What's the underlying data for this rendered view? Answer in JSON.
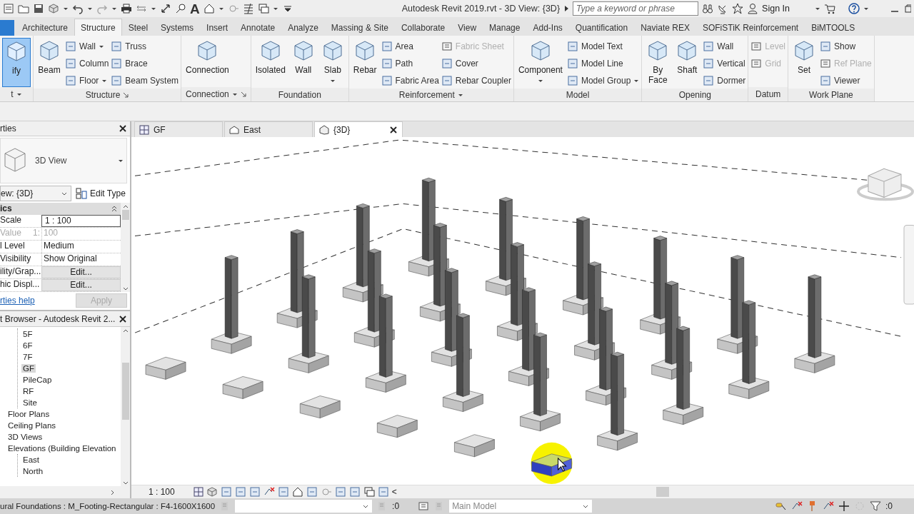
{
  "title_bar": {
    "text_tool": "A",
    "title": "Autodesk Revit 2019.rvt - 3D View: {3D}",
    "search": {
      "placeholder": "Type a keyword or phrase"
    },
    "sign_in": "Sign In"
  },
  "ribbon_tabs": [
    {
      "label": "Architecture",
      "selected": false
    },
    {
      "label": "Structure",
      "selected": true
    },
    {
      "label": "Steel",
      "selected": false
    },
    {
      "label": "Systems",
      "selected": false
    },
    {
      "label": "Insert",
      "selected": false
    },
    {
      "label": "Annotate",
      "selected": false
    },
    {
      "label": "Analyze",
      "selected": false
    },
    {
      "label": "Massing & Site",
      "selected": false
    },
    {
      "label": "Collaborate",
      "selected": false
    },
    {
      "label": "View",
      "selected": false
    },
    {
      "label": "Manage",
      "selected": false
    },
    {
      "label": "Add-Ins",
      "selected": false
    },
    {
      "label": "Quantification",
      "selected": false
    },
    {
      "label": "Naviate REX",
      "selected": false
    },
    {
      "label": "SOFiSTiK Reinforcement",
      "selected": false
    },
    {
      "label": "BiMTOOLS",
      "selected": false
    }
  ],
  "ribbon_panels": [
    {
      "title": "t",
      "menu": true,
      "launcher": false,
      "columns": [
        {
          "kind": "large",
          "label": "ify",
          "active": true,
          "dropdown": false
        }
      ]
    },
    {
      "title": "Structure",
      "menu": false,
      "launcher": true,
      "columns": [
        {
          "kind": "large",
          "label": "Beam",
          "active": false,
          "dropdown": false
        },
        {
          "kind": "stack",
          "items": [
            {
              "label": "Wall",
              "dropdown": true,
              "disabled": false
            },
            {
              "label": "Column",
              "dropdown": false,
              "disabled": false
            },
            {
              "label": "Floor",
              "dropdown": true,
              "disabled": false
            }
          ]
        },
        {
          "kind": "stack",
          "items": [
            {
              "label": "Truss",
              "dropdown": false,
              "disabled": false
            },
            {
              "label": "Brace",
              "dropdown": false,
              "disabled": false
            },
            {
              "label": "Beam System",
              "dropdown": false,
              "disabled": false
            }
          ]
        }
      ]
    },
    {
      "title": "Connection",
      "menu": true,
      "launcher": true,
      "columns": [
        {
          "kind": "large",
          "label": "Connection",
          "active": false,
          "dropdown": false
        }
      ]
    },
    {
      "title": "Foundation",
      "menu": false,
      "launcher": false,
      "columns": [
        {
          "kind": "large",
          "label": "Isolated",
          "active": false,
          "dropdown": false
        },
        {
          "kind": "large",
          "label": "Wall",
          "active": false,
          "dropdown": false
        },
        {
          "kind": "large",
          "label": "Slab",
          "active": false,
          "dropdown": true
        }
      ]
    },
    {
      "title": "Reinforcement",
      "menu": true,
      "launcher": false,
      "columns": [
        {
          "kind": "large",
          "label": "Rebar",
          "active": false,
          "dropdown": false
        },
        {
          "kind": "stack",
          "items": [
            {
              "label": "Area",
              "dropdown": false,
              "disabled": false
            },
            {
              "label": "Path",
              "dropdown": false,
              "disabled": false
            },
            {
              "label": "Fabric Area",
              "dropdown": false,
              "disabled": false
            }
          ]
        },
        {
          "kind": "stack",
          "items": [
            {
              "label": "Fabric Sheet",
              "dropdown": false,
              "disabled": true
            },
            {
              "label": "Cover",
              "dropdown": false,
              "disabled": false
            },
            {
              "label": "Rebar Coupler",
              "dropdown": false,
              "disabled": false
            }
          ]
        }
      ]
    },
    {
      "title": "Model",
      "menu": false,
      "launcher": false,
      "columns": [
        {
          "kind": "large",
          "label": "Component",
          "active": false,
          "dropdown": true
        },
        {
          "kind": "stack",
          "items": [
            {
              "label": "Model Text",
              "dropdown": false,
              "disabled": false
            },
            {
              "label": "Model Line",
              "dropdown": false,
              "disabled": false
            },
            {
              "label": "Model Group",
              "dropdown": true,
              "disabled": false
            }
          ]
        }
      ]
    },
    {
      "title": "Opening",
      "menu": false,
      "launcher": false,
      "columns": [
        {
          "kind": "large",
          "label": "By Face",
          "active": false,
          "dropdown": false
        },
        {
          "kind": "large",
          "label": "Shaft",
          "active": false,
          "dropdown": false
        },
        {
          "kind": "stack",
          "items": [
            {
              "label": "Wall",
              "dropdown": false,
              "disabled": false
            },
            {
              "label": "Vertical",
              "dropdown": false,
              "disabled": false
            },
            {
              "label": "Dormer",
              "dropdown": false,
              "disabled": false
            }
          ]
        }
      ]
    },
    {
      "title": "Datum",
      "menu": false,
      "launcher": false,
      "columns": [
        {
          "kind": "stack",
          "items": [
            {
              "label": "Level",
              "dropdown": false,
              "disabled": true
            },
            {
              "label": "Grid",
              "dropdown": false,
              "disabled": true
            }
          ]
        }
      ]
    },
    {
      "title": "Work Plane",
      "menu": false,
      "launcher": false,
      "columns": [
        {
          "kind": "large",
          "label": "Set",
          "active": false,
          "dropdown": false
        },
        {
          "kind": "stack",
          "items": [
            {
              "label": "Show",
              "dropdown": false,
              "disabled": false
            },
            {
              "label": "Ref Plane",
              "dropdown": false,
              "disabled": true
            },
            {
              "label": "Viewer",
              "dropdown": false,
              "disabled": false
            }
          ]
        }
      ]
    }
  ],
  "properties": {
    "title": "rties",
    "type_name": "3D View",
    "view_selector": "ew: {3D}",
    "edit_type": "Edit Type",
    "group": "ics",
    "rows": [
      {
        "kind": "input",
        "name": "Scale",
        "value": "1 : 100"
      },
      {
        "kind": "readonly",
        "name": "Value",
        "prefix": "1:",
        "value": "100"
      },
      {
        "kind": "text",
        "name": "l Level",
        "value": "Medium"
      },
      {
        "kind": "text",
        "name": "Visibility",
        "value": "Show Original"
      },
      {
        "kind": "button",
        "name": "ility/Grap...",
        "value": "Edit..."
      },
      {
        "kind": "button",
        "name": "hic Displ...",
        "value": "Edit..."
      }
    ],
    "help_link": "rties help",
    "apply": {
      "label": "Apply",
      "disabled": true
    }
  },
  "project_browser": {
    "title": "t Browser - Autodesk Revit 2...",
    "tree": [
      {
        "children": [
          {
            "label": "5F",
            "selected": false
          },
          {
            "label": "6F",
            "selected": false
          },
          {
            "label": "7F",
            "selected": false
          },
          {
            "label": "GF",
            "selected": true
          },
          {
            "label": "PileCap",
            "selected": false
          },
          {
            "label": "RF",
            "selected": false
          },
          {
            "label": "Site",
            "selected": false
          }
        ]
      },
      {
        "label": "Floor Plans",
        "selected": false
      },
      {
        "label": "Ceiling Plans",
        "selected": false
      },
      {
        "label": "3D Views",
        "selected": false
      },
      {
        "label": "Elevations (Building Elevation",
        "selected": false,
        "children": [
          {
            "label": "East",
            "selected": false
          },
          {
            "label": "North",
            "selected": false
          }
        ]
      }
    ]
  },
  "view_tabs": [
    {
      "kind": "plan",
      "label": "GF",
      "selected": false
    },
    {
      "kind": "elevation",
      "label": "East",
      "selected": false
    },
    {
      "kind": "model",
      "label": "{3D}",
      "selected": true
    }
  ],
  "view_control": {
    "scale": "1 : 100",
    "more": "<"
  },
  "status_bar": {
    "text": "ural Foundations : M_Footing-Rectangular : F4-1600X1600",
    "workset_count": ":0",
    "design_option": "Main Model",
    "filter_count": ":0"
  }
}
